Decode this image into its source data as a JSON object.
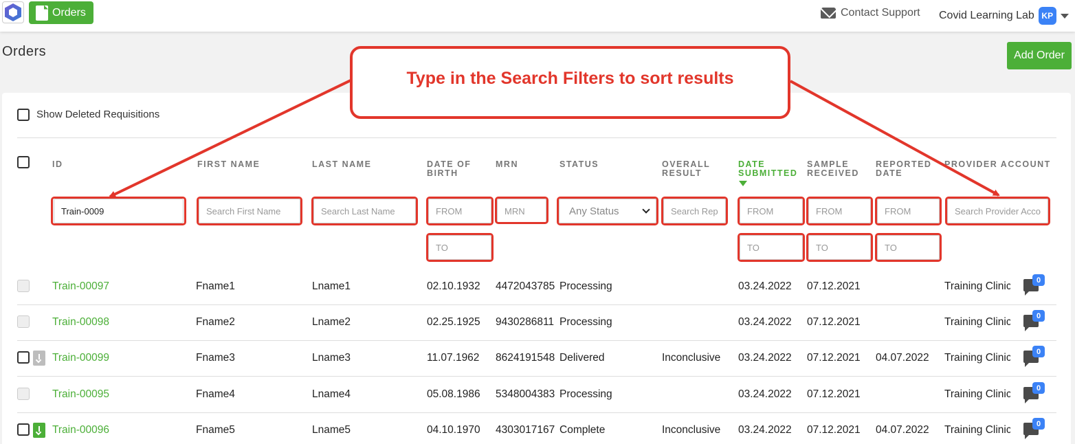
{
  "topbar": {
    "orders_tab": "Orders",
    "contact_support": "Contact Support",
    "lab_name": "Covid Learning Lab",
    "avatar_initials": "KP"
  },
  "page": {
    "title": "Orders",
    "add_order": "Add Order",
    "show_deleted": "Show Deleted Requisitions"
  },
  "callout": "Type in the Search Filters to sort results",
  "columns": {
    "id": "ID",
    "first_name": "FIRST NAME",
    "last_name": "LAST NAME",
    "dob_1": "DATE OF",
    "dob_2": "BIRTH",
    "mrn": "MRN",
    "status": "STATUS",
    "overall_1": "OVERALL",
    "overall_2": "RESULT",
    "submitted_1": "DATE",
    "submitted_2": "SUBMITTED",
    "received_1": "SAMPLE",
    "received_2": "RECEIVED",
    "reported_1": "REPORTED",
    "reported_2": "DATE",
    "provider": "PROVIDER ACCOUNT"
  },
  "filters": {
    "id_value": "Train-0009",
    "first_name_ph": "Search First Name",
    "last_name_ph": "Search Last Name",
    "from_ph": "FROM",
    "to_ph": "TO",
    "mrn_ph": "MRN",
    "status_value": "Any Status",
    "overall_ph": "Search Report",
    "provider_ph": "Search Provider Account"
  },
  "rows": [
    {
      "id": "Train-00097",
      "first": "Fname1",
      "last": "Lname1",
      "dob": "02.10.1932",
      "mrn": "4472043785",
      "status": "Processing",
      "overall": "",
      "submitted": "03.24.2022",
      "received": "07.12.2021",
      "reported": "",
      "provider": "Training Clinic",
      "comments": "0"
    },
    {
      "id": "Train-00098",
      "first": "Fname2",
      "last": "Lname2",
      "dob": "02.25.1925",
      "mrn": "9430286811",
      "status": "Processing",
      "overall": "",
      "submitted": "03.24.2022",
      "received": "07.12.2021",
      "reported": "",
      "provider": "Training Clinic",
      "comments": "0"
    },
    {
      "id": "Train-00099",
      "first": "Fname3",
      "last": "Lname3",
      "dob": "11.07.1962",
      "mrn": "8624191548",
      "status": "Delivered",
      "overall": "Inconclusive",
      "submitted": "03.24.2022",
      "received": "07.12.2021",
      "reported": "04.07.2022",
      "provider": "Training Clinic",
      "comments": "0"
    },
    {
      "id": "Train-00095",
      "first": "Fname4",
      "last": "Lname4",
      "dob": "05.08.1986",
      "mrn": "5348004383",
      "status": "Processing",
      "overall": "",
      "submitted": "03.24.2022",
      "received": "07.12.2021",
      "reported": "",
      "provider": "Training Clinic",
      "comments": "0"
    },
    {
      "id": "Train-00096",
      "first": "Fname5",
      "last": "Lname5",
      "dob": "04.10.1970",
      "mrn": "4303017167",
      "status": "Complete",
      "overall": "Inconclusive",
      "submitted": "03.24.2022",
      "received": "07.12.2021",
      "reported": "04.07.2022",
      "provider": "Training Clinic",
      "comments": "0"
    }
  ],
  "colors": {
    "brand_green": "#4caf38",
    "annotation_red": "#e2362b",
    "badge_blue": "#3b82f6"
  }
}
